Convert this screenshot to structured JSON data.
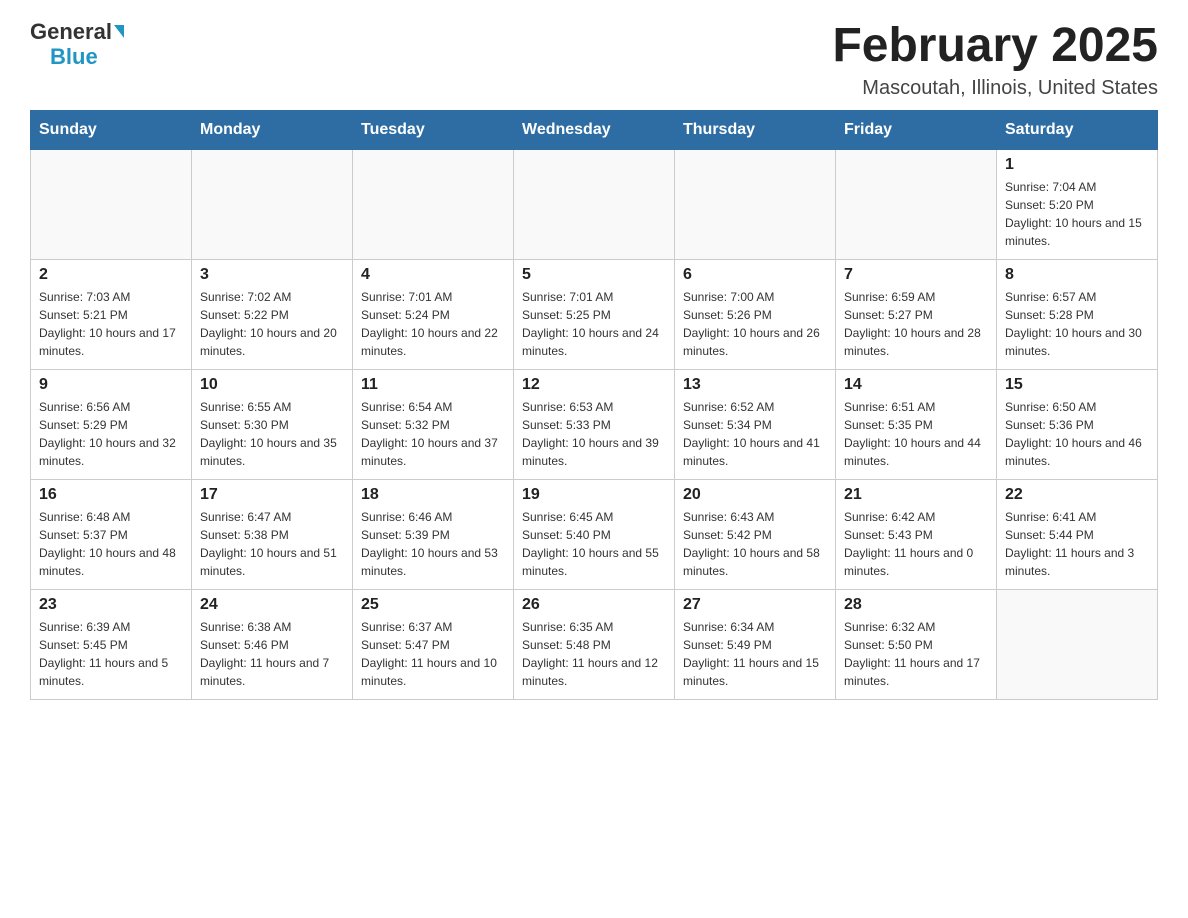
{
  "header": {
    "logo_general": "General",
    "logo_blue": "Blue",
    "title": "February 2025",
    "location": "Mascoutah, Illinois, United States"
  },
  "weekdays": [
    "Sunday",
    "Monday",
    "Tuesday",
    "Wednesday",
    "Thursday",
    "Friday",
    "Saturday"
  ],
  "weeks": [
    [
      {
        "day": "",
        "info": ""
      },
      {
        "day": "",
        "info": ""
      },
      {
        "day": "",
        "info": ""
      },
      {
        "day": "",
        "info": ""
      },
      {
        "day": "",
        "info": ""
      },
      {
        "day": "",
        "info": ""
      },
      {
        "day": "1",
        "info": "Sunrise: 7:04 AM\nSunset: 5:20 PM\nDaylight: 10 hours and 15 minutes."
      }
    ],
    [
      {
        "day": "2",
        "info": "Sunrise: 7:03 AM\nSunset: 5:21 PM\nDaylight: 10 hours and 17 minutes."
      },
      {
        "day": "3",
        "info": "Sunrise: 7:02 AM\nSunset: 5:22 PM\nDaylight: 10 hours and 20 minutes."
      },
      {
        "day": "4",
        "info": "Sunrise: 7:01 AM\nSunset: 5:24 PM\nDaylight: 10 hours and 22 minutes."
      },
      {
        "day": "5",
        "info": "Sunrise: 7:01 AM\nSunset: 5:25 PM\nDaylight: 10 hours and 24 minutes."
      },
      {
        "day": "6",
        "info": "Sunrise: 7:00 AM\nSunset: 5:26 PM\nDaylight: 10 hours and 26 minutes."
      },
      {
        "day": "7",
        "info": "Sunrise: 6:59 AM\nSunset: 5:27 PM\nDaylight: 10 hours and 28 minutes."
      },
      {
        "day": "8",
        "info": "Sunrise: 6:57 AM\nSunset: 5:28 PM\nDaylight: 10 hours and 30 minutes."
      }
    ],
    [
      {
        "day": "9",
        "info": "Sunrise: 6:56 AM\nSunset: 5:29 PM\nDaylight: 10 hours and 32 minutes."
      },
      {
        "day": "10",
        "info": "Sunrise: 6:55 AM\nSunset: 5:30 PM\nDaylight: 10 hours and 35 minutes."
      },
      {
        "day": "11",
        "info": "Sunrise: 6:54 AM\nSunset: 5:32 PM\nDaylight: 10 hours and 37 minutes."
      },
      {
        "day": "12",
        "info": "Sunrise: 6:53 AM\nSunset: 5:33 PM\nDaylight: 10 hours and 39 minutes."
      },
      {
        "day": "13",
        "info": "Sunrise: 6:52 AM\nSunset: 5:34 PM\nDaylight: 10 hours and 41 minutes."
      },
      {
        "day": "14",
        "info": "Sunrise: 6:51 AM\nSunset: 5:35 PM\nDaylight: 10 hours and 44 minutes."
      },
      {
        "day": "15",
        "info": "Sunrise: 6:50 AM\nSunset: 5:36 PM\nDaylight: 10 hours and 46 minutes."
      }
    ],
    [
      {
        "day": "16",
        "info": "Sunrise: 6:48 AM\nSunset: 5:37 PM\nDaylight: 10 hours and 48 minutes."
      },
      {
        "day": "17",
        "info": "Sunrise: 6:47 AM\nSunset: 5:38 PM\nDaylight: 10 hours and 51 minutes."
      },
      {
        "day": "18",
        "info": "Sunrise: 6:46 AM\nSunset: 5:39 PM\nDaylight: 10 hours and 53 minutes."
      },
      {
        "day": "19",
        "info": "Sunrise: 6:45 AM\nSunset: 5:40 PM\nDaylight: 10 hours and 55 minutes."
      },
      {
        "day": "20",
        "info": "Sunrise: 6:43 AM\nSunset: 5:42 PM\nDaylight: 10 hours and 58 minutes."
      },
      {
        "day": "21",
        "info": "Sunrise: 6:42 AM\nSunset: 5:43 PM\nDaylight: 11 hours and 0 minutes."
      },
      {
        "day": "22",
        "info": "Sunrise: 6:41 AM\nSunset: 5:44 PM\nDaylight: 11 hours and 3 minutes."
      }
    ],
    [
      {
        "day": "23",
        "info": "Sunrise: 6:39 AM\nSunset: 5:45 PM\nDaylight: 11 hours and 5 minutes."
      },
      {
        "day": "24",
        "info": "Sunrise: 6:38 AM\nSunset: 5:46 PM\nDaylight: 11 hours and 7 minutes."
      },
      {
        "day": "25",
        "info": "Sunrise: 6:37 AM\nSunset: 5:47 PM\nDaylight: 11 hours and 10 minutes."
      },
      {
        "day": "26",
        "info": "Sunrise: 6:35 AM\nSunset: 5:48 PM\nDaylight: 11 hours and 12 minutes."
      },
      {
        "day": "27",
        "info": "Sunrise: 6:34 AM\nSunset: 5:49 PM\nDaylight: 11 hours and 15 minutes."
      },
      {
        "day": "28",
        "info": "Sunrise: 6:32 AM\nSunset: 5:50 PM\nDaylight: 11 hours and 17 minutes."
      },
      {
        "day": "",
        "info": ""
      }
    ]
  ]
}
